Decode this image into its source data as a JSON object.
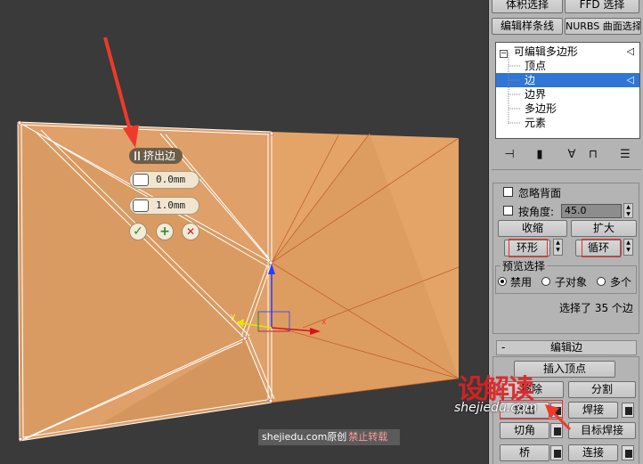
{
  "viewport": {
    "caddy_title": "挤出边",
    "height_value": "0.0mm",
    "width_value": "1.0mm",
    "ok_glyph": "✓",
    "apply_glyph": "+",
    "cancel_glyph": "✕",
    "axis_x": "x",
    "axis_y": "y",
    "mesh_color": "#e3a164",
    "watermark_site": "shejiedu.com原创",
    "watermark_note": "禁止转载"
  },
  "panel": {
    "top_buttons": [
      "体积选择",
      "FFD 选择",
      "编辑样条线",
      "NURBS 曲面选择"
    ],
    "stack": {
      "root": "可编辑多边形",
      "items": [
        "顶点",
        "边",
        "边界",
        "多边形",
        "元素"
      ],
      "selected": "边"
    },
    "selection": {
      "ignore_backfacing": "忽略背面",
      "by_angle": "按角度:",
      "angle_value": "45.0",
      "shrink": "收缩",
      "grow": "扩大",
      "ring": "环形",
      "loop": "循环",
      "preview_group": "预览选择",
      "preview_options": [
        "禁用",
        "子对象",
        "多个"
      ],
      "preview_selected": "禁用",
      "status": "选择了 35 个边"
    },
    "edit_edges": {
      "title": "编辑边",
      "insert_vertex": "插入顶点",
      "remove": "移除",
      "split": "分割",
      "extrude": "挤出",
      "weld": "焊接",
      "chamfer": "切角",
      "target_weld": "目标焊接",
      "bridge": "桥",
      "connect": "连接"
    }
  },
  "logo": {
    "brand_cn": "设解读",
    "brand_url": "shejiedu.com",
    "color": "#e02020"
  }
}
